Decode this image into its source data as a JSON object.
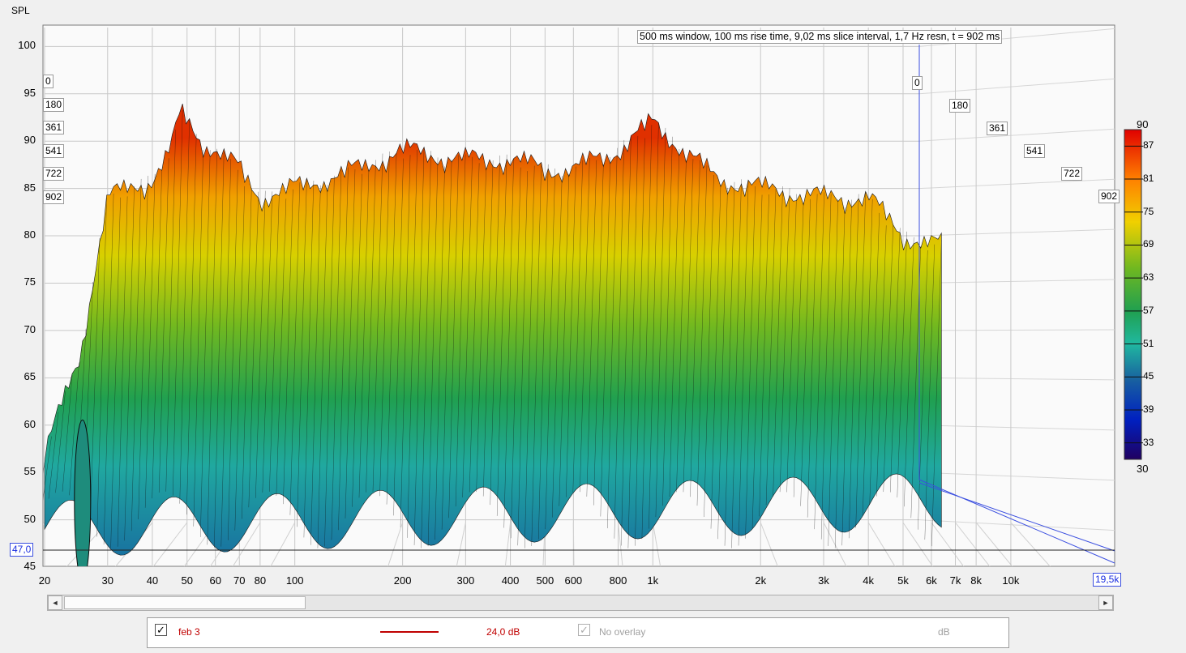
{
  "chart_data": {
    "type": "waterfall",
    "ylabel": "SPL",
    "info": "500 ms window, 100 ms rise time, 9,02 ms slice interval, 1,7 Hz resn, t = 902 ms",
    "y_ticks": [
      "100",
      "95",
      "90",
      "85",
      "80",
      "75",
      "70",
      "65",
      "60",
      "55",
      "50",
      "45"
    ],
    "ylim": [
      45,
      102
    ],
    "x_ticks": [
      "20",
      "30",
      "40",
      "50",
      "60",
      "70",
      "80",
      "100",
      "200",
      "300",
      "400",
      "500",
      "600",
      "800",
      "1k",
      "2k",
      "3k",
      "4k",
      "5k",
      "6k",
      "7k",
      "8k",
      "10k"
    ],
    "x_tick_values": [
      20,
      30,
      40,
      50,
      60,
      70,
      80,
      100,
      200,
      300,
      400,
      500,
      600,
      800,
      1000,
      2000,
      3000,
      4000,
      5000,
      6000,
      7000,
      8000,
      10000
    ],
    "xlim": [
      20,
      19500
    ],
    "x_scale": "log",
    "x_end_label": "19,5k",
    "floor_marker": "47,0",
    "time_labels": [
      "0",
      "180",
      "361",
      "541",
      "722",
      "902"
    ],
    "colorbar_top": "90",
    "colorbar_bottom": "30",
    "colorbar_ticks": [
      "87",
      "81",
      "75",
      "69",
      "63",
      "57",
      "51",
      "45",
      "39",
      "33"
    ],
    "peaks": {
      "freqs": [
        20,
        25,
        30,
        35,
        40,
        45,
        48,
        55,
        60,
        70,
        80,
        100,
        150,
        200,
        300,
        400,
        500,
        600,
        800,
        1000,
        1500,
        2000,
        3000,
        4000,
        5000,
        6000
      ],
      "spl": [
        57,
        67,
        84,
        85,
        86,
        89,
        93,
        90,
        89,
        87,
        84,
        85,
        87,
        89,
        88,
        88,
        87,
        87,
        89,
        92,
        86,
        85,
        84,
        84,
        80,
        79
      ]
    },
    "series": [
      {
        "name": "feb 3"
      }
    ]
  },
  "scrollbar": {
    "left_arrow": "◄",
    "right_arrow": "►"
  },
  "legend": {
    "check_mark": "✓",
    "label": "feb 3",
    "level": "24,0 dB",
    "overlay_label": "No overlay",
    "unit": "dB",
    "line_color": "#c00000"
  }
}
